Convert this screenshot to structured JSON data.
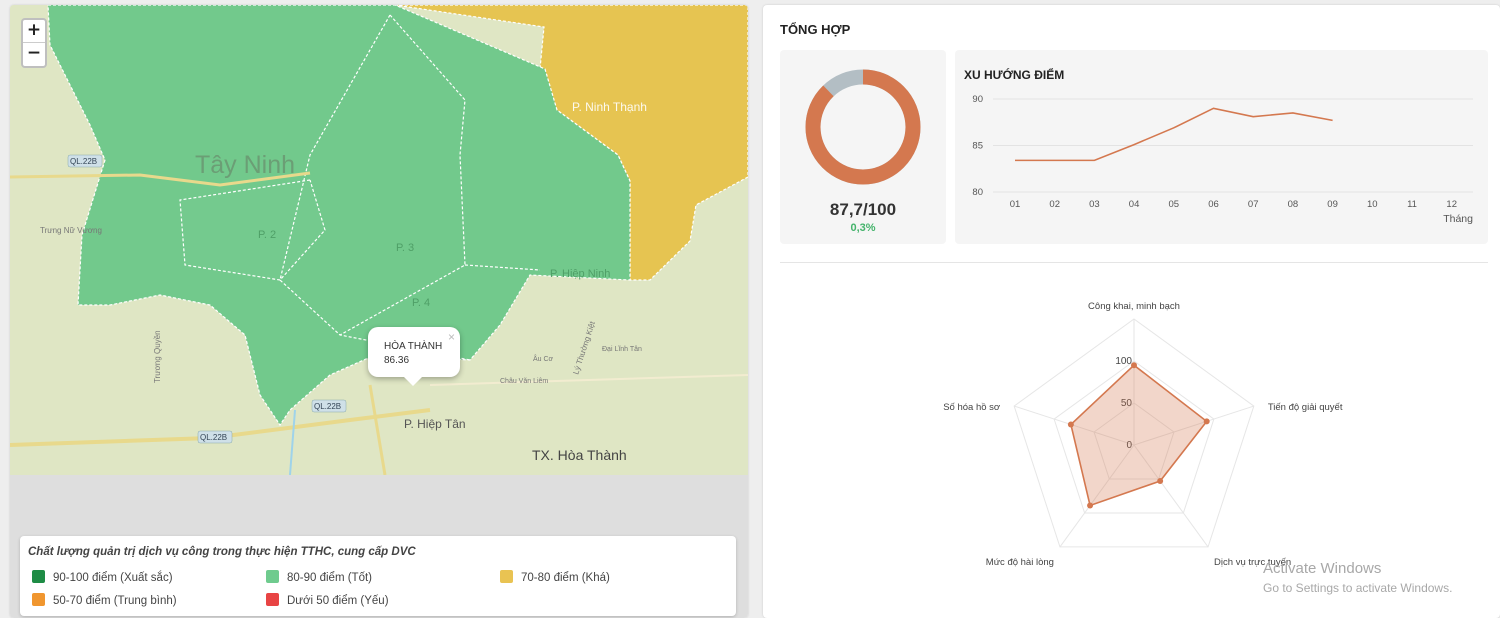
{
  "map": {
    "zoom_in": "+",
    "zoom_out": "−",
    "labels": {
      "tay_ninh": "Tây Ninh",
      "ninh_thanh": "P. Ninh Thạnh",
      "p2": "P. 2",
      "p3": "P. 3",
      "hiep_ninh": "P. Hiệp Ninh",
      "p4": "P. 4",
      "hiep_tan": "P. Hiệp Tân",
      "tx_hoa_thanh": "TX. Hòa Thành",
      "ql22b": "QL.22B",
      "trung_nu_vuong": "Trưng Nữ Vương",
      "truong_quyen": "Trương Quyền",
      "ly_thuong_kiet": "Lý Thường Kiệt",
      "au_co": "Âu Cơ",
      "chau_van_liem": "Châu Văn Liêm",
      "dai_linh_tan": "Đại Lĩnh Tân"
    },
    "colors": {
      "excellent": "#1e8c45",
      "good": "#6fcb8e",
      "fair": "#e9c352",
      "average": "#f0962f",
      "weak": "#e84444"
    },
    "popup": {
      "name": "HÒA THÀNH",
      "value": "86.36",
      "close": "×"
    }
  },
  "legend": {
    "title": "Chất lượng quản trị dịch vụ công trong thực hiện TTHC, cung cấp DVC",
    "items": [
      {
        "label": "90-100 điểm (Xuất sắc)",
        "color": "#1e8c45"
      },
      {
        "label": "80-90 điểm (Tốt)",
        "color": "#6fcb8e"
      },
      {
        "label": "70-80 điểm (Khá)",
        "color": "#e9c352"
      },
      {
        "label": "50-70 điểm (Trung bình)",
        "color": "#f0962f"
      },
      {
        "label": "Dưới 50 điểm (Yếu)",
        "color": "#e84444"
      }
    ]
  },
  "summary": {
    "title": "TỔNG HỢP",
    "score": "87,7/100",
    "change": "0,3%",
    "score_value": 87.7,
    "score_max": 100,
    "donut_colors": {
      "score": "#d4784f",
      "rest": "#b3bec4"
    }
  },
  "chart_data": [
    {
      "type": "line",
      "title": "XU HƯỚNG ĐIỂM",
      "xlabel": "Tháng",
      "x": [
        "01",
        "02",
        "03",
        "04",
        "05",
        "06",
        "07",
        "08",
        "09",
        "10",
        "11",
        "12"
      ],
      "series": [
        {
          "values": [
            83.4,
            83.4,
            83.4,
            85.1,
            86.9,
            89.0,
            88.1,
            88.5,
            87.7,
            null,
            null,
            null
          ],
          "color": "#d4784f"
        }
      ],
      "yticks": [
        "80",
        "85",
        "90"
      ],
      "ylim": [
        80,
        90
      ]
    },
    {
      "type": "radar",
      "axes": [
        "Công khai, minh bạch",
        "Tiến độ giải quyết",
        "Dịch vụ trực tuyến",
        "Mức độ hài lòng",
        "Số hóa hồ sơ"
      ],
      "values": [
        95,
        91,
        53,
        89,
        79
      ],
      "rticks": [
        "0",
        "50",
        "100"
      ],
      "rlim": [
        0,
        150
      ],
      "color": "#d4784f"
    }
  ],
  "watermark": {
    "line1": "Activate Windows",
    "line2": "Go to Settings to activate Windows."
  }
}
